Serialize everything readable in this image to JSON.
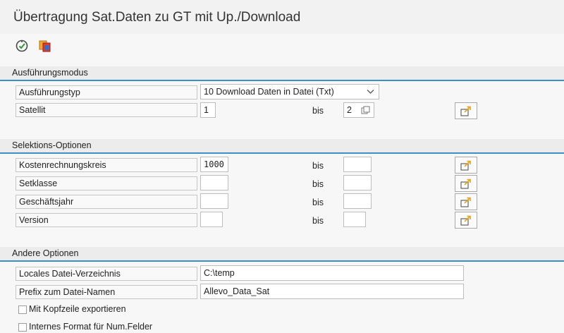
{
  "window": {
    "title": "Übertragung Sat.Daten zu GT mit Up./Download"
  },
  "toolbar": {
    "execute_icon": "execute-icon",
    "variant_icon": "variants-icon"
  },
  "sections": {
    "execution": {
      "header": "Ausführungsmodus",
      "type_label": "Ausführungstyp",
      "type_value": "10 Download Daten in Datei (Txt)",
      "satellite_label": "Satellit",
      "satellite_from": "1",
      "satellite_to": "2",
      "bis": "bis"
    },
    "selection": {
      "header": "Selektions-Optionen",
      "rows": [
        {
          "label": "Kostenrechnungskreis",
          "from": "1000",
          "to": ""
        },
        {
          "label": "Setklasse",
          "from": "",
          "to": ""
        },
        {
          "label": "Geschäftsjahr",
          "from": "",
          "to": ""
        },
        {
          "label": "Version",
          "from": "",
          "to": ""
        }
      ],
      "bis": "bis"
    },
    "other": {
      "header": "Andere Optionen",
      "dir_label": "Locales Datei-Verzeichnis",
      "dir_value": "C:\\temp",
      "prefix_label": "Prefix zum Datei-Namen",
      "prefix_value": "Allevo_Data_Sat",
      "checkbox1_label": "Mit Kopfzeile exportieren",
      "checkbox1_checked": false,
      "checkbox2_label": "Internes Format für Num.Felder",
      "checkbox2_checked": false
    }
  },
  "colors": {
    "accent": "#3e8ec7",
    "section_bg": "#ececec"
  }
}
